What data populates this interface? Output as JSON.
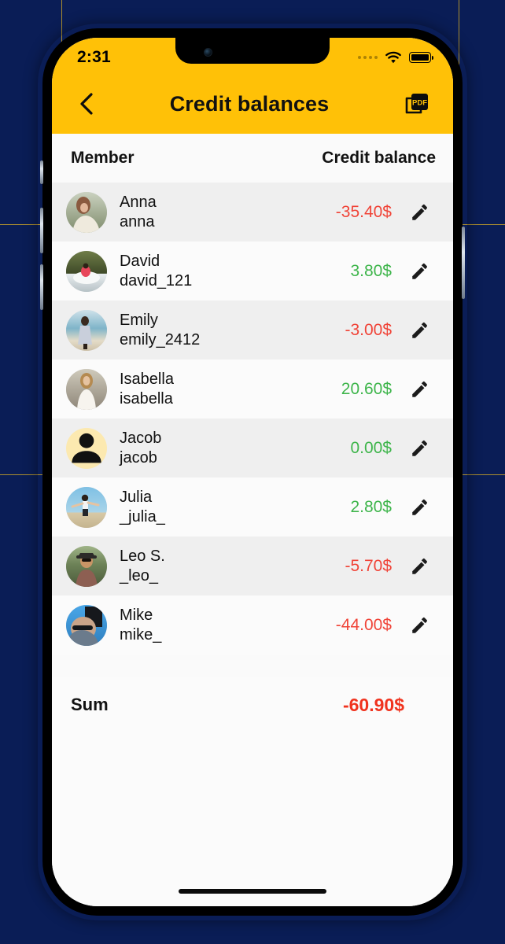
{
  "background": {
    "color": "#0A1D56",
    "accent_line": "#C9A227"
  },
  "theme": {
    "brand_yellow": "#FFC107",
    "negative": "#F04438",
    "positive": "#3EB54B",
    "sum_negative": "#F0331E",
    "row_alt": "#EFEFEF",
    "row_base": "#FBFBFB"
  },
  "status_bar": {
    "time": "2:31",
    "signal_icon": "signal-dots-icon",
    "wifi_icon": "wifi-icon",
    "battery_icon": "battery-full-icon"
  },
  "app_bar": {
    "back_icon": "chevron-left-icon",
    "title": "Credit balances",
    "export_icon": "pdf-export-icon",
    "export_label": "PDF"
  },
  "table": {
    "columns": {
      "member": "Member",
      "balance": "Credit balance"
    },
    "rows": [
      {
        "name": "Anna",
        "handle": "anna",
        "amount": "-35.40$",
        "sign": "neg",
        "avatar": "photo",
        "edit_icon": "pencil-icon"
      },
      {
        "name": "David",
        "handle": "david_121",
        "amount": "3.80$",
        "sign": "pos",
        "avatar": "photo",
        "edit_icon": "pencil-icon"
      },
      {
        "name": "Emily",
        "handle": "emily_2412",
        "amount": "-3.00$",
        "sign": "neg",
        "avatar": "photo",
        "edit_icon": "pencil-icon"
      },
      {
        "name": "Isabella",
        "handle": "isabella",
        "amount": "20.60$",
        "sign": "pos",
        "avatar": "photo",
        "edit_icon": "pencil-icon"
      },
      {
        "name": "Jacob",
        "handle": "jacob",
        "amount": "0.00$",
        "sign": "pos",
        "avatar": "placeholder",
        "edit_icon": "pencil-icon"
      },
      {
        "name": "Julia",
        "handle": "_julia_",
        "amount": "2.80$",
        "sign": "pos",
        "avatar": "photo",
        "edit_icon": "pencil-icon"
      },
      {
        "name": "Leo S.",
        "handle": "_leo_",
        "amount": "-5.70$",
        "sign": "neg",
        "avatar": "photo",
        "edit_icon": "pencil-icon"
      },
      {
        "name": "Mike",
        "handle": "mike_",
        "amount": "-44.00$",
        "sign": "neg",
        "avatar": "photo",
        "edit_icon": "pencil-icon"
      }
    ]
  },
  "summary": {
    "label": "Sum",
    "value": "-60.90$"
  }
}
